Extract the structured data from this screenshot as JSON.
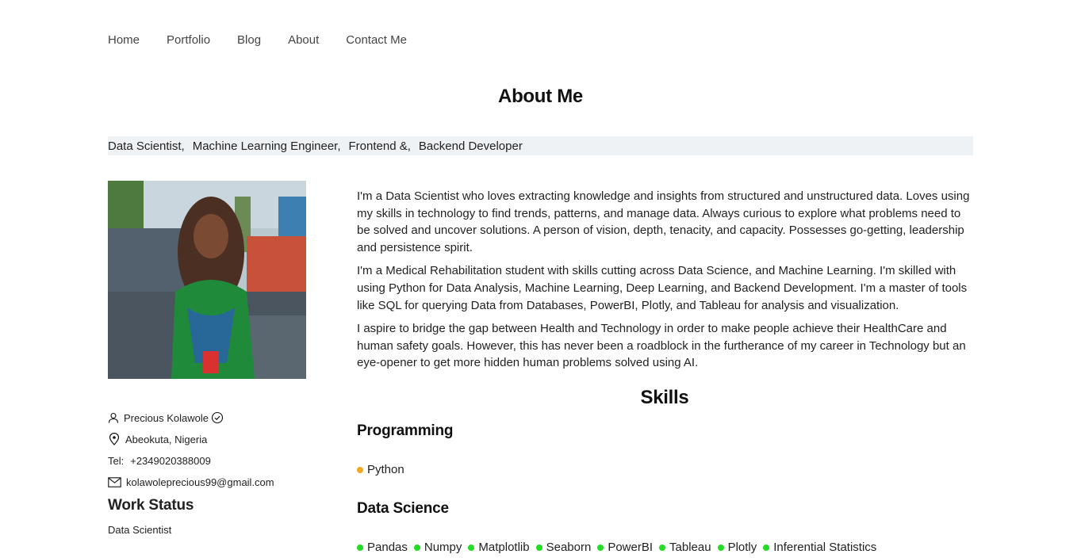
{
  "nav": {
    "items": [
      "Home",
      "Portfolio",
      "Blog",
      "About",
      "Contact Me"
    ]
  },
  "page_title": "About Me",
  "roles": [
    "Data Scientist,",
    "Machine Learning Engineer,",
    "Frontend &,",
    "Backend Developer"
  ],
  "profile": {
    "name": "Precious Kolawole",
    "location": "Abeokuta, Nigeria",
    "tel_label": "Tel:",
    "tel": "+2349020388009",
    "email": "kolawoleprecious99@gmail.com",
    "icons": [
      "person-icon",
      "verified-icon",
      "location-pin-icon",
      "mail-icon"
    ]
  },
  "work_status": {
    "title": "Work Status",
    "value": "Data Scientist"
  },
  "bio": [
    "I'm a Data Scientist who loves extracting knowledge and insights from structured and unstructured data. Loves using my skills in technology to find trends, patterns, and manage data. Always curious to explore what problems need to be solved and uncover solutions. A person of vision, depth, tenacity, and capacity. Possesses go-getting, leadership and persistence spirit.",
    "I'm a Medical Rehabilitation student with skills cutting across Data Science, and Machine Learning. I'm skilled with using Python for Data Analysis, Machine Learning, Deep Learning, and Backend Development. I'm a master of tools like SQL for querying Data from Databases, PowerBI, Plotly, and Tableau for analysis and visualization.",
    "I aspire to bridge the gap between Health and Technology in order to make people achieve their HealthCare and human safety goals. However, this has never been a roadblock in the furtherance of my career in Technology but an eye-opener to get more hidden human problems solved using AI."
  ],
  "skills": {
    "title": "Skills",
    "categories": [
      {
        "title": "Programming",
        "dot_color": "#f5a623",
        "items": [
          "Python"
        ]
      },
      {
        "title": "Data Science",
        "dot_color": "#22dd22",
        "items": [
          "Pandas",
          "Numpy",
          "Matplotlib",
          "Seaborn",
          "PowerBI",
          "Tableau",
          "Plotly",
          "Inferential Statistics"
        ]
      }
    ]
  }
}
